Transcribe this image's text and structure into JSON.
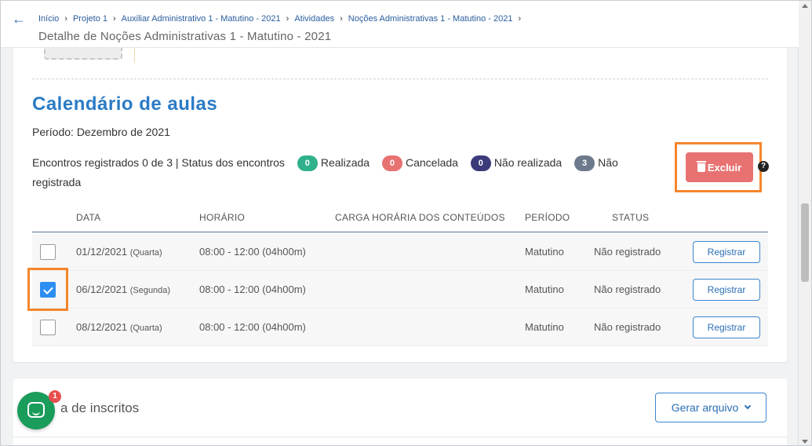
{
  "header": {
    "breadcrumbs": [
      "Início",
      "Projeto 1",
      "Auxiliar Administrativo 1 - Matutino - 2021",
      "Atividades",
      "Noções Administrativas 1 - Matutino - 2021"
    ],
    "title": "Detalhe de Noções Administrativas 1 - Matutino - 2021"
  },
  "calendar": {
    "title": "Calendário de aulas",
    "periodo": "Período: Dezembro de 2021",
    "encontros_prefix": "Encontros registrados 0 de 3 | Status dos encontros",
    "statuses": [
      {
        "count": "0",
        "label": "Realizada",
        "color": "#2fb18b"
      },
      {
        "count": "0",
        "label": "Cancelada",
        "color": "#e87272"
      },
      {
        "count": "0",
        "label": "Não realizada",
        "color": "#3b3a7a"
      },
      {
        "count": "3",
        "label": "Não registrada",
        "color": "#6c7a8c"
      }
    ],
    "excluir_label": "Excluir",
    "help": "?"
  },
  "table": {
    "headers": [
      "DATA",
      "HORÁRIO",
      "CARGA HORÁRIA DOS CONTEÚDOS",
      "PERÍODO",
      "STATUS"
    ],
    "rows": [
      {
        "date": "01/12/2021",
        "weekday": "(Quarta)",
        "time": "08:00 - 12:00 (04h00m)",
        "carga": "",
        "periodo": "Matutino",
        "status": "Não registrado",
        "action": "Registrar",
        "checked": false
      },
      {
        "date": "06/12/2021",
        "weekday": "(Segunda)",
        "time": "08:00 - 12:00 (04h00m)",
        "carga": "",
        "periodo": "Matutino",
        "status": "Não registrado",
        "action": "Registrar",
        "checked": true
      },
      {
        "date": "08/12/2021",
        "weekday": "(Quarta)",
        "time": "08:00 - 12:00 (04h00m)",
        "carga": "",
        "periodo": "Matutino",
        "status": "Não registrado",
        "action": "Registrar",
        "checked": false
      }
    ]
  },
  "inscritos": {
    "title": "a de inscritos",
    "gerar_label": "Gerar arquivo"
  },
  "chat": {
    "badge": "1"
  }
}
